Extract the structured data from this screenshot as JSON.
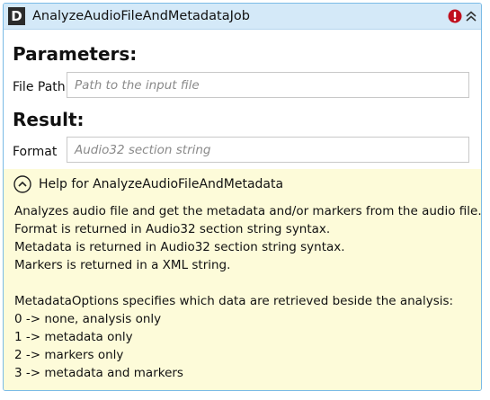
{
  "window": {
    "title": "AnalyzeAudioFileAndMetadataJob",
    "logo_letter": "D",
    "error_icon": "error-icon",
    "collapse_icon": "chevron-double-up-icon",
    "colors": {
      "title_bar": "#d4e9f8",
      "border": "#7bbbe6",
      "help_background": "#fdfbd9",
      "error_red": "#c0101e"
    }
  },
  "parameters": {
    "heading": "Parameters:",
    "file_path": {
      "label": "File Path",
      "value": "",
      "placeholder": "Path to the input file"
    }
  },
  "result": {
    "heading": "Result:",
    "format": {
      "label": "Format",
      "value": "",
      "placeholder": "Audio32 section string"
    }
  },
  "help": {
    "toggle_icon": "chevron-up-circle-icon",
    "title": "Help for AnalyzeAudioFileAndMetadata",
    "lines": [
      "Analyzes audio file and get the metadata and/or markers from the audio file.",
      "Format is returned in Audio32 section string syntax.",
      "Metadata is returned in Audio32 section string syntax.",
      "Markers is returned in a XML string.",
      "",
      "MetadataOptions specifies which data are retrieved beside the analysis:",
      "0 -> none, analysis only",
      "1 -> metadata only",
      "2 -> markers only",
      "3 -> metadata and markers"
    ]
  }
}
